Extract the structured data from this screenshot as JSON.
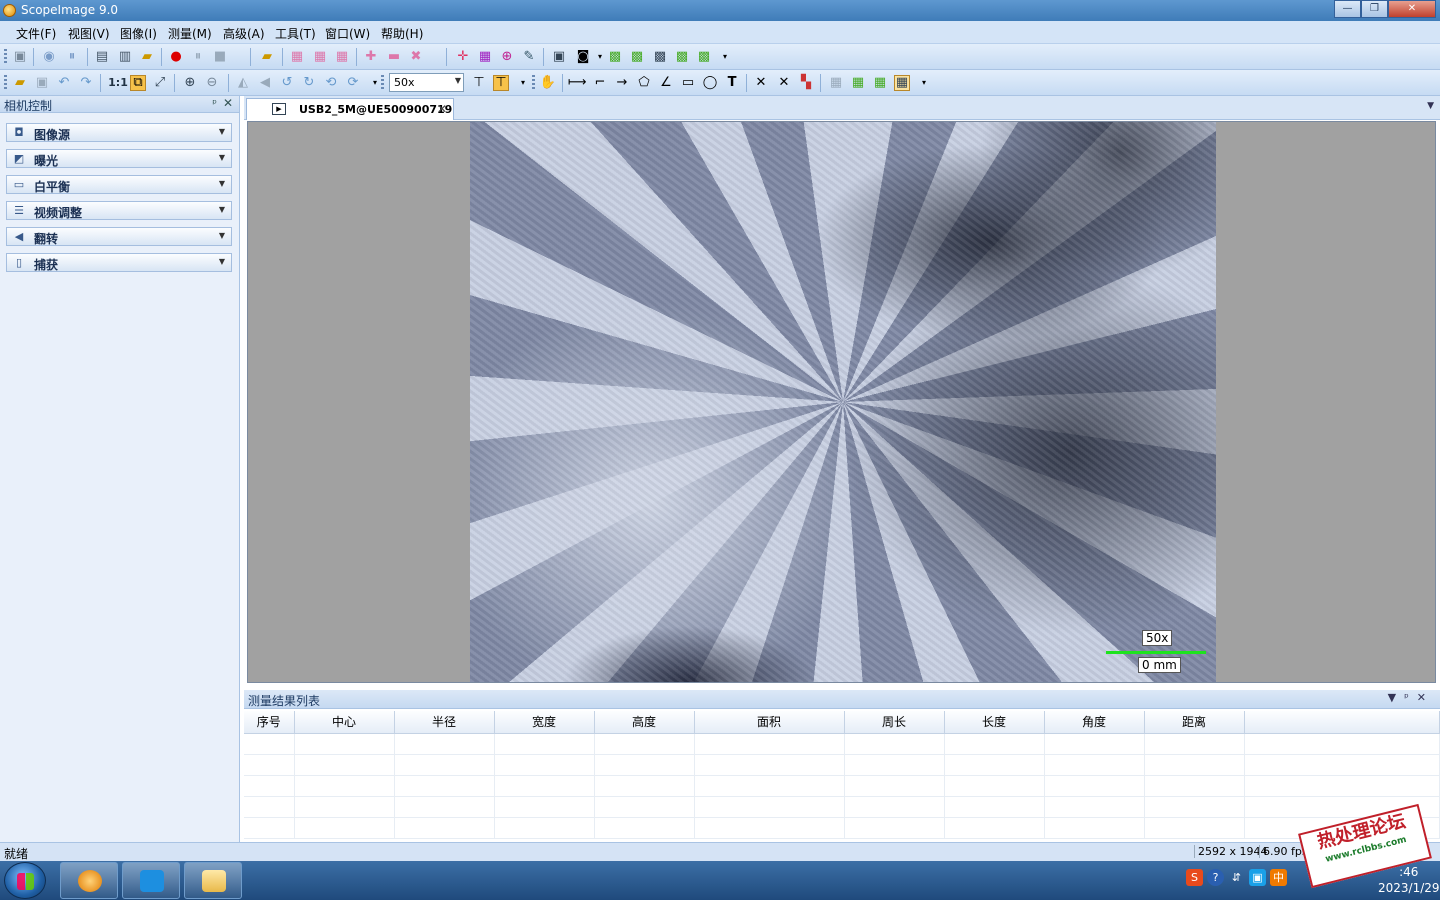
{
  "window": {
    "title": "ScopeImage 9.0",
    "buttons": [
      "—",
      "❐",
      "✕"
    ]
  },
  "menu": [
    {
      "label": "文件(F)"
    },
    {
      "label": "视图(V)"
    },
    {
      "label": "图像(I)"
    },
    {
      "label": "测量(M)"
    },
    {
      "label": "高级(A)"
    },
    {
      "label": "工具(T)"
    },
    {
      "label": "窗口(W)"
    },
    {
      "label": "帮助(H)"
    }
  ],
  "toolbar": {
    "zoom_value": "50x",
    "one_to_one": "1:1",
    "text_tool": "T"
  },
  "left_panel": {
    "title": "相机控制",
    "items": [
      {
        "label": "图像源",
        "icon": "camera-source-icon"
      },
      {
        "label": "曝光",
        "icon": "exposure-icon"
      },
      {
        "label": "白平衡",
        "icon": "white-balance-icon"
      },
      {
        "label": "视频调整",
        "icon": "video-adjust-icon"
      },
      {
        "label": "翻转",
        "icon": "flip-icon"
      },
      {
        "label": "捕获",
        "icon": "capture-icon"
      }
    ]
  },
  "document_tab": {
    "label": "USB2_5M@UE500900719"
  },
  "image": {
    "scale_magnification": "50x",
    "scale_length": "0 mm"
  },
  "results": {
    "title": "测量结果列表",
    "columns": [
      "序号",
      "中心",
      "半径",
      "宽度",
      "高度",
      "面积",
      "周长",
      "长度",
      "角度",
      "距离"
    ]
  },
  "status": {
    "text": "就绪",
    "resolution": "2592 x 1944",
    "fps": "6.90 fps"
  },
  "taskbar": {
    "clock_time": ":46",
    "clock_date": "2023/1/29"
  },
  "watermark": {
    "text": "热处理论坛",
    "url": "www.rclbbs.com"
  },
  "colors": {
    "scale_bar": "#1de31d",
    "title_bar": "#4a88c4",
    "accent": "#c6dbf3"
  }
}
